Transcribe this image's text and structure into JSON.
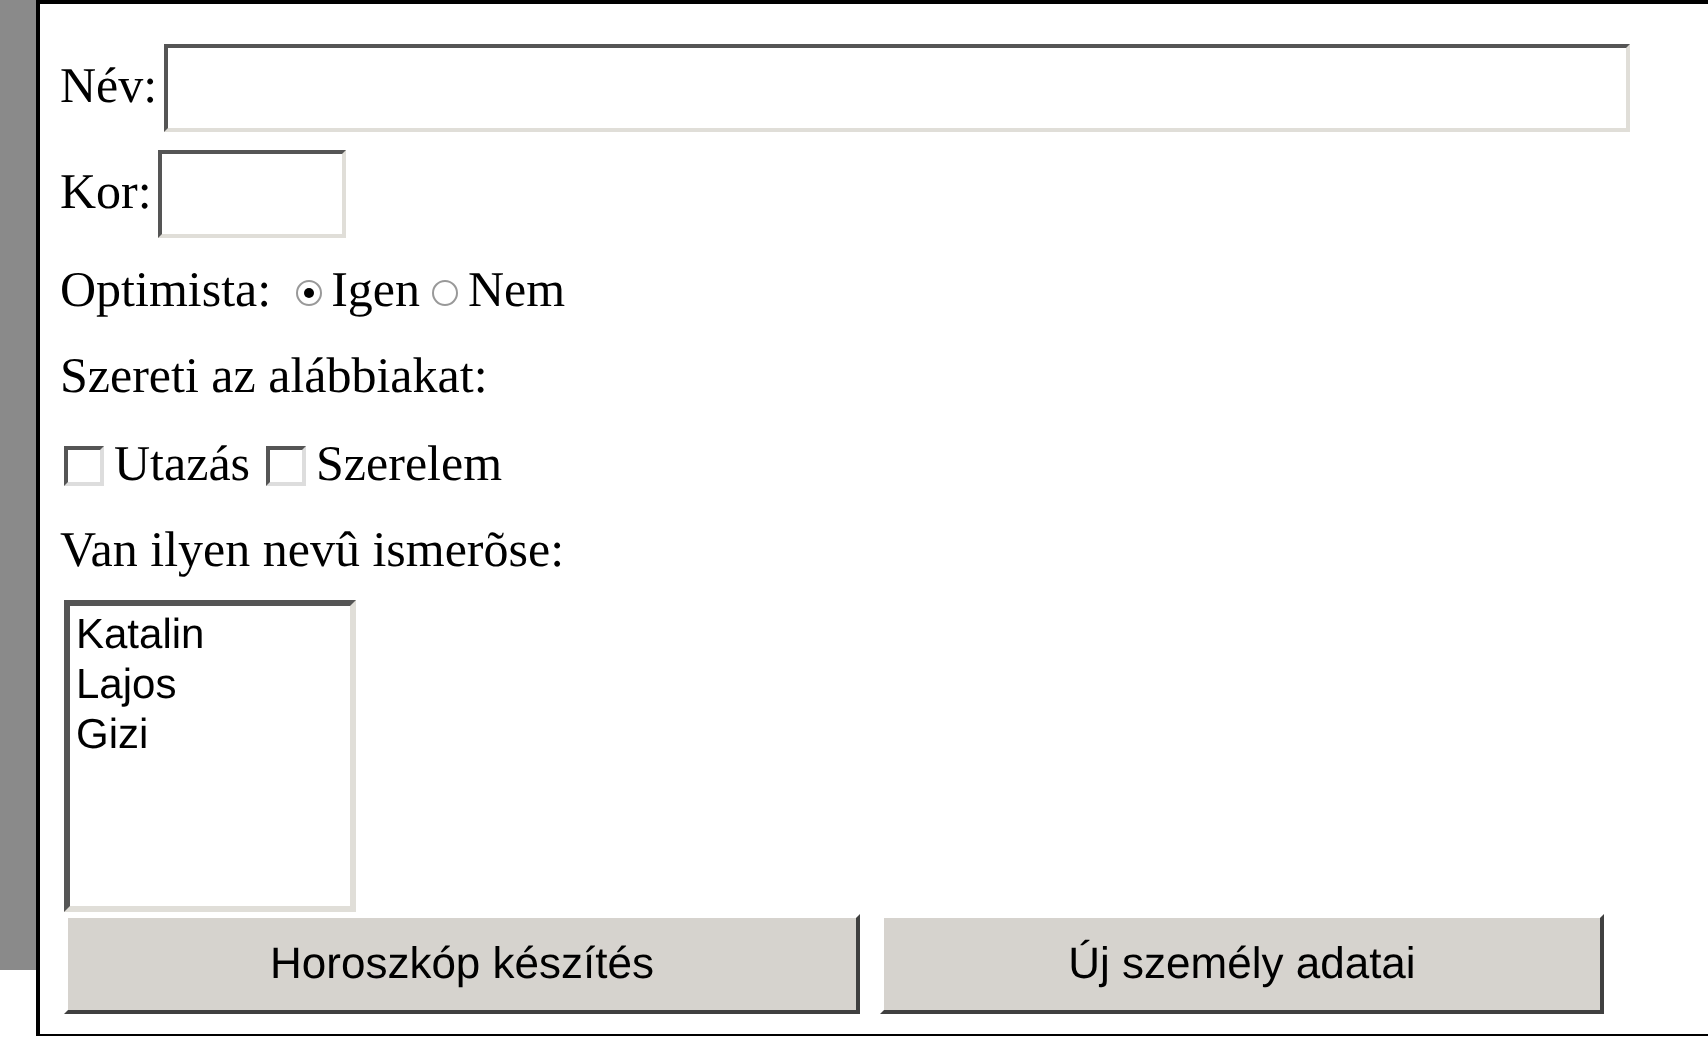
{
  "name_field": {
    "label": "Név:"
  },
  "age_field": {
    "label": "Kor:"
  },
  "optimist": {
    "label": "Optimista:",
    "options": [
      {
        "label": "Igen",
        "selected": true
      },
      {
        "label": "Nem",
        "selected": false
      }
    ]
  },
  "likes": {
    "label": "Szereti az alábbiakat:",
    "options": [
      {
        "label": "Utazás",
        "checked": false
      },
      {
        "label": "Szerelem",
        "checked": false
      }
    ]
  },
  "acquaintance": {
    "label": "Van ilyen nevû ismerõse:",
    "items": [
      {
        "label": "Katalin",
        "selected": false
      },
      {
        "label": "Lajos",
        "selected": false
      },
      {
        "label": "Gizi",
        "selected": false
      }
    ]
  },
  "buttons": [
    {
      "label": "Horoszkóp készítés"
    },
    {
      "label": "Új személy adatai"
    }
  ]
}
